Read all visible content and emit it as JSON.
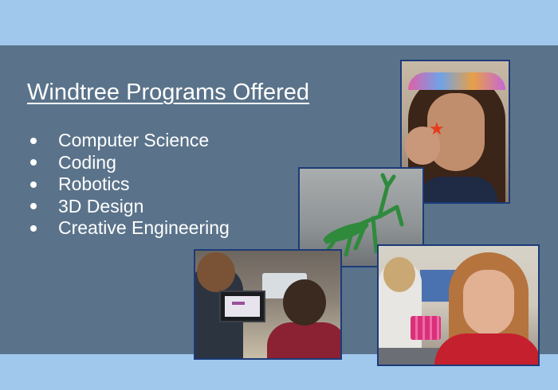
{
  "slide": {
    "title": "Windtree Programs Offered",
    "programs": [
      "Computer Science",
      "Coding",
      "Robotics",
      "3D Design",
      "Creative Engineering"
    ]
  },
  "colors": {
    "background_band": "#9fc8ec",
    "panel": "#5a738a",
    "text": "#ffffff",
    "photo_border": "#1d3a78"
  },
  "icons": {
    "bullet": "filled-circle"
  }
}
